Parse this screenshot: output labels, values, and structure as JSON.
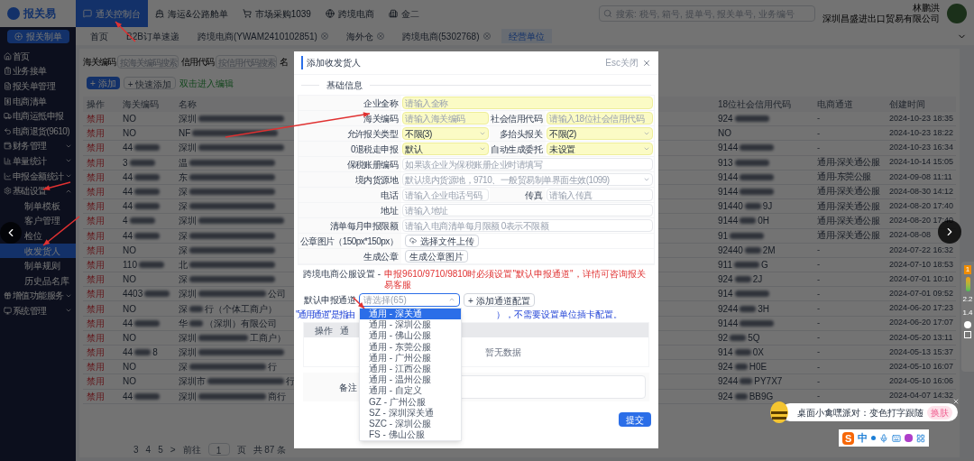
{
  "app": {
    "logo": "报关易",
    "main_button": "报关制单"
  },
  "top_nav": [
    {
      "label": "通关控制台",
      "selected": true
    },
    {
      "label": "海运&公路舱单",
      "selected": false
    },
    {
      "label": "市场采购1039",
      "selected": false
    },
    {
      "label": "跨境电商",
      "selected": false
    },
    {
      "label": "金二",
      "selected": false
    }
  ],
  "search": {
    "placeholder": "搜索: 税号, 箱号, 提单号, 报关单号, 业务编号"
  },
  "user": {
    "name": "林鹏洪",
    "company": "深圳昌盛进出口贸易有限公司"
  },
  "page_tabs": [
    {
      "label": "首页",
      "selected": false,
      "closable": false
    },
    {
      "label": "B2B订单速递",
      "selected": false,
      "closable": false
    },
    {
      "label": "跨境电商(YWAM2410102851)",
      "selected": false,
      "closable": true
    },
    {
      "label": "海外仓",
      "selected": false,
      "closable": true
    },
    {
      "label": "跨境电商(5302768)",
      "selected": false,
      "closable": true
    },
    {
      "label": "经营单位",
      "selected": true,
      "closable": false
    }
  ],
  "sidebar": [
    {
      "label": "首页",
      "kind": "link"
    },
    {
      "label": "业务接单",
      "kind": "link"
    },
    {
      "label": "报关单管理",
      "kind": "link"
    },
    {
      "label": "电商清单",
      "kind": "link"
    },
    {
      "label": "电商运抵申报",
      "kind": "link"
    },
    {
      "label": "电商退货(9610)",
      "kind": "link"
    },
    {
      "label": "财务管理",
      "kind": "group",
      "expanded": false
    },
    {
      "label": "单量统计",
      "kind": "group",
      "expanded": false
    },
    {
      "label": "申报金额统计",
      "kind": "group",
      "expanded": false
    },
    {
      "label": "基础设置",
      "kind": "group",
      "expanded": true,
      "children": [
        {
          "label": "制单模板",
          "selected": false
        },
        {
          "label": "客户管理",
          "selected": false
        },
        {
          "label": "检位",
          "selected": false
        },
        {
          "label": "收发货人",
          "selected": true
        },
        {
          "label": "制单规则",
          "selected": false
        },
        {
          "label": "历史品名库",
          "selected": false
        }
      ]
    },
    {
      "label": "增值功能服务",
      "kind": "group",
      "expanded": false
    },
    {
      "label": "系统管理",
      "kind": "group",
      "expanded": false
    }
  ],
  "filters": [
    {
      "label": "海关编码",
      "placeholder": "按海关编码搜索"
    },
    {
      "label": "信用代码",
      "placeholder": "按信用代码搜索"
    },
    {
      "label": "名"
    }
  ],
  "toolbar": [
    {
      "label": "+ 添加",
      "kind": "primary"
    },
    {
      "label": "+ 快速添加",
      "kind": "plain"
    },
    {
      "label": "双击进入编辑",
      "kind": "hint"
    }
  ],
  "table": {
    "columns": [
      "操作",
      "海关编码",
      "名称",
      "18位社会信用代码",
      "电商通道",
      "创建时间"
    ],
    "rows": [
      {
        "action": "禁用",
        "code": {
          "head": "NO",
          "redacted": false
        },
        "name": {
          "head": "深圳",
          "redacted": true
        },
        "credit": {
          "head": "924",
          "redacted": true
        },
        "channel": "-",
        "created": "2024-10-23 18:35"
      },
      {
        "action": "禁用",
        "code": {
          "head": "NO",
          "redacted": false
        },
        "name": {
          "head": "NF",
          "redacted": true
        },
        "credit": {
          "head": "NO",
          "redacted": false
        },
        "channel": "-",
        "created": "2024-10-23 18:22"
      },
      {
        "action": "禁用",
        "code": {
          "head": "44",
          "redacted": true
        },
        "name": {
          "head": "深圳",
          "redacted": true
        },
        "credit": {
          "head": "9144",
          "redacted": true
        },
        "channel": "-",
        "created": "2024-10-23 16:34"
      },
      {
        "action": "禁用",
        "code": {
          "head": "3",
          "redacted": true
        },
        "name": {
          "head": "温",
          "redacted": true
        },
        "credit": {
          "head": "913",
          "redacted": true
        },
        "channel": "通用-深关通公服",
        "created": "2024-10-14 15:05"
      },
      {
        "action": "禁用",
        "code": {
          "head": "44",
          "redacted": true
        },
        "name": {
          "head": "东",
          "redacted": true
        },
        "credit": {
          "head": "9144",
          "redacted": true
        },
        "channel": "通用-东莞公服",
        "created": "2024-09-08 11:11"
      },
      {
        "action": "禁用",
        "code": {
          "head": "44",
          "redacted": true
        },
        "name": {
          "head": "深",
          "redacted": true
        },
        "credit": {
          "head": "9144",
          "redacted": true
        },
        "channel": "通用-深关通公服",
        "created": "2024-08-30 14:12"
      },
      {
        "action": "禁用",
        "code": {
          "head": "44",
          "redacted": true
        },
        "name": {
          "head": "深",
          "redacted": true
        },
        "credit": {
          "head": "91440",
          "tail": "9J",
          "redacted": true
        },
        "channel": "通用-深关通公服",
        "created": "2024-08-20 17:40"
      },
      {
        "action": "禁用",
        "code": {
          "head": "4",
          "redacted": true
        },
        "name": {
          "head": "深圳",
          "redacted": true
        },
        "credit": {
          "head": "9144",
          "tail": "0H",
          "redacted": true
        },
        "channel": "通用-深关通公服",
        "created": "2024-08-20 17:40"
      },
      {
        "action": "禁用",
        "code": {
          "head": "44",
          "redacted": true
        },
        "name": {
          "head": "深",
          "redacted": true
        },
        "credit": {
          "head": "91",
          "redacted": true
        },
        "channel": "通用-深关通公服",
        "created": "2024-08-08"
      },
      {
        "action": "禁用",
        "code": {
          "head": "NO",
          "redacted": false
        },
        "name": {
          "head": "深",
          "redacted": true
        },
        "credit": {
          "head": "92440",
          "tail": "2M",
          "redacted": true
        },
        "channel": "-",
        "created": "2024-07-22 16:32"
      },
      {
        "action": "禁用",
        "code": {
          "head": "110",
          "redacted": true
        },
        "name": {
          "head": "北",
          "redacted": true
        },
        "credit": {
          "head": "911",
          "tail": "G",
          "redacted": true
        },
        "channel": "-",
        "created": "2024-07-10 18:53"
      },
      {
        "action": "禁用",
        "code": {
          "head": "NO",
          "redacted": false
        },
        "name": {
          "head": "深",
          "redacted": true
        },
        "credit": {
          "head": "924",
          "tail": "2J",
          "redacted": true
        },
        "channel": "-",
        "created": "2024-07-01 10:10"
      },
      {
        "action": "禁用",
        "code": {
          "head": "4403",
          "redacted": true
        },
        "name": {
          "head": "深圳",
          "tail": "公司",
          "redacted": true
        },
        "credit": {
          "head": "914",
          "redacted": true
        },
        "channel": "-",
        "created": "2024-07-01 09:52"
      },
      {
        "action": "禁用",
        "code": {
          "head": "NO",
          "redacted": false
        },
        "name": {
          "head": "深",
          "tail": "行（个体工商户）",
          "redacted": true
        },
        "credit": {
          "head": "9244",
          "tail": "3H",
          "redacted": true
        },
        "channel": "-",
        "created": "2024-06-20 17:23"
      },
      {
        "action": "禁用",
        "code": {
          "head": "44",
          "redacted": true
        },
        "name": {
          "head": "华",
          "tail": "（深圳）有限公司",
          "redacted": true
        },
        "credit": {
          "head": "9144",
          "redacted": true
        },
        "channel": "-",
        "created": "2024-06-20 17:07"
      },
      {
        "action": "禁用",
        "code": {
          "head": "NO",
          "redacted": false
        },
        "name": {
          "head": "深圳",
          "tail": "工商户）",
          "redacted": true
        },
        "credit": {
          "head": "92",
          "tail": "5Q",
          "redacted": true
        },
        "channel": "-",
        "created": "2024-05-20 13:11"
      },
      {
        "action": "禁用",
        "code": {
          "head": "44",
          "tail": "8",
          "redacted": true
        },
        "name": {
          "head": "深圳",
          "redacted": true
        },
        "credit": {
          "head": "914",
          "tail": "0X",
          "redacted": true
        },
        "channel": "-",
        "created": "2024-05-13 15:37"
      },
      {
        "action": "禁用",
        "code": {
          "head": "NO",
          "redacted": false
        },
        "name": {
          "head": "深",
          "tail": "行",
          "redacted": true
        },
        "credit": {
          "head": "924",
          "tail": "H0E",
          "redacted": true
        },
        "channel": "-",
        "created": "2024-05-10 16:07"
      },
      {
        "action": "禁用",
        "code": {
          "head": "NO",
          "redacted": false
        },
        "name": {
          "head": "深圳市",
          "tail": "行",
          "redacted": true
        },
        "credit": {
          "head": "9244",
          "tail": "PY7X7",
          "redacted": true
        },
        "channel": "-",
        "created": "2024-05-10 16:06"
      },
      {
        "action": "禁用",
        "code": {
          "head": "44",
          "redacted": true
        },
        "name": {
          "head": "深圳",
          "tail": "商行",
          "redacted": true
        },
        "credit": {
          "head": "924",
          "tail": "BB9G",
          "redacted": true
        },
        "channel": "-",
        "created": "2024-04-07 14:32"
      }
    ]
  },
  "pagination": {
    "pages": [
      "3",
      "4",
      "5"
    ],
    "next": ">",
    "goto_label": "前往",
    "goto_value": "1",
    "page_unit": "页",
    "total": "共 87 条"
  },
  "dialog": {
    "title": "添加收发货人",
    "esc_hint": "Esc关闭",
    "section_basic": "基础信息",
    "rows": [
      {
        "fields": [
          {
            "label": "企业全称",
            "kind": "input",
            "placeholder": "请输入全称",
            "required": true
          }
        ]
      },
      {
        "fields": [
          {
            "label": "海关编码",
            "kind": "input",
            "placeholder": "请输入海关编码",
            "required": true
          },
          {
            "label": "社会信用代码",
            "kind": "input",
            "placeholder": "请输入18位社会信用代码",
            "required": true
          }
        ]
      },
      {
        "fields": [
          {
            "label": "允许报关类型",
            "kind": "select",
            "value": "不限(3)",
            "required": true
          },
          {
            "label": "多抬头报关",
            "kind": "select",
            "value": "不限(2)",
            "required": true
          }
        ]
      },
      {
        "fields": [
          {
            "label": "0退税走申报",
            "kind": "select",
            "value": "默认",
            "required": true
          },
          {
            "label": "自动生成委托",
            "kind": "select",
            "value": "未设置",
            "required": true
          }
        ]
      },
      {
        "fields": [
          {
            "label": "保税账册编码",
            "kind": "input",
            "placeholder": "如果该企业为保税账册企业时请填写",
            "required": false
          }
        ]
      },
      {
        "fields": [
          {
            "label": "境内货源地",
            "kind": "select",
            "placeholder": "默认境内货源地，9710、一般贸易制单界面生效(1099)",
            "required": false
          }
        ]
      },
      {
        "fields": [
          {
            "label": "电话",
            "kind": "input",
            "placeholder": "请输入企业电话号码",
            "required": false
          },
          {
            "label": "传真",
            "kind": "input",
            "placeholder": "请输入传真",
            "required": false
          }
        ]
      },
      {
        "fields": [
          {
            "label": "地址",
            "kind": "input",
            "placeholder": "请输入地址",
            "required": false
          }
        ]
      },
      {
        "fields": [
          {
            "label": "清单每月申报限额",
            "kind": "input",
            "placeholder": "请输入电商清单每月限额 0表示不限额",
            "required": false
          }
        ]
      },
      {
        "fields": [
          {
            "label": "公章图片（150px*150px）",
            "kind": "upload",
            "value": "选择文件上传"
          }
        ]
      },
      {
        "fields": [
          {
            "label": "生成公章",
            "kind": "button",
            "value": "生成公章图片"
          }
        ]
      }
    ],
    "section_cross": "跨境电商公服设置 -",
    "section_cross_note": "申报9610/9710/9810时必须设置\"默认申报通道\"，详情可咨询报关易客服",
    "channel_label": "默认申报通道",
    "channel_placeholder": "请选择(65)",
    "channel_open": true,
    "add_channel": "+ 添加通道配置",
    "note_left": "\"通用通道\" 是指由",
    "note_right": "），不需要设置单位插卡配置。",
    "grid_columns": [
      "操作",
      "通"
    ],
    "empty": "暂无数据",
    "remark_label": "备注",
    "submit": "提交",
    "dropdown": [
      {
        "label": "通用 - 深关通",
        "selected": true
      },
      {
        "label": "通用 - 深圳公服",
        "selected": false
      },
      {
        "label": "通用 - 佛山公服",
        "selected": false
      },
      {
        "label": "通用 - 东莞公服",
        "selected": false
      },
      {
        "label": "通用 - 广州公服",
        "selected": false
      },
      {
        "label": "通用 - 江西公服",
        "selected": false
      },
      {
        "label": "通用 - 温州公服",
        "selected": false
      },
      {
        "label": "通用 - 自定义",
        "selected": false
      },
      {
        "label": "GZ - 广州公服",
        "selected": false
      },
      {
        "label": "SZ - 深圳深关通",
        "selected": false
      },
      {
        "label": "SZC - 深圳公服",
        "selected": false
      },
      {
        "label": "FS - 佛山公服",
        "selected": false
      }
    ]
  },
  "popup": {
    "text": "桌面小禽嘿派对：变色打字跟随",
    "button": "换肤"
  },
  "ime": {
    "logo": "S",
    "mode": "中"
  },
  "monitor": {
    "badge": "1",
    "readings": [
      "2.2",
      "1.4"
    ]
  }
}
